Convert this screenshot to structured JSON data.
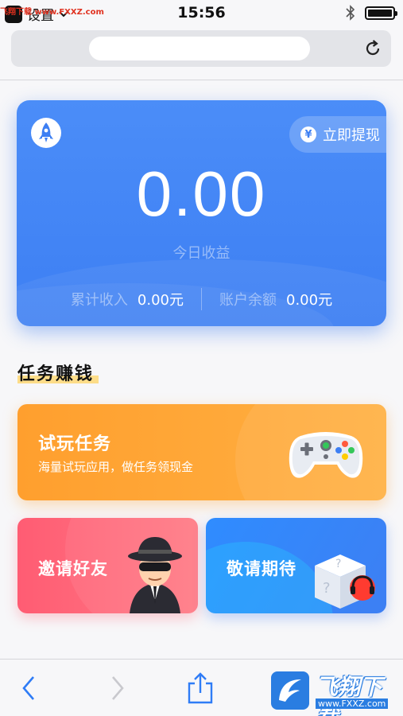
{
  "status_bar": {
    "watermark": "飞翔下载 www.FXXZ.com",
    "carrier": "设置",
    "time": "15:56",
    "battery_level": 1.0
  },
  "url_bar": {
    "reload_icon": "reload-icon"
  },
  "balance_card": {
    "logo_icon": "rocket-logo-icon",
    "withdraw_label": "立即提现",
    "withdraw_icon_glyph": "¥",
    "today_amount": "0.00",
    "today_label": "今日收益",
    "total_income_label": "累计收入",
    "total_income_value": "0.00元",
    "balance_label": "账户余额",
    "balance_value": "0.00元",
    "accent_color": "#3d7ff3"
  },
  "section": {
    "title": "任务赚钱"
  },
  "tasks": {
    "trial": {
      "title": "试玩任务",
      "subtitle": "海量试玩应用，做任务领现金",
      "icon": "gamepad-icon",
      "color": "#ffa23a"
    },
    "invite": {
      "title": "邀请好友",
      "icon": "spy-icon",
      "color": "#ff6378"
    },
    "coming_soon": {
      "title": "敬请期待",
      "icon": "mystery-cube-icon",
      "color": "#3d7ff3"
    }
  },
  "toolbar": {
    "back_icon": "back-arrow-icon",
    "forward_icon": "forward-arrow-icon",
    "share_icon": "share-icon",
    "brand_watermark": "飞翔下载",
    "brand_watermark_url": "www.FXXZ.com"
  }
}
